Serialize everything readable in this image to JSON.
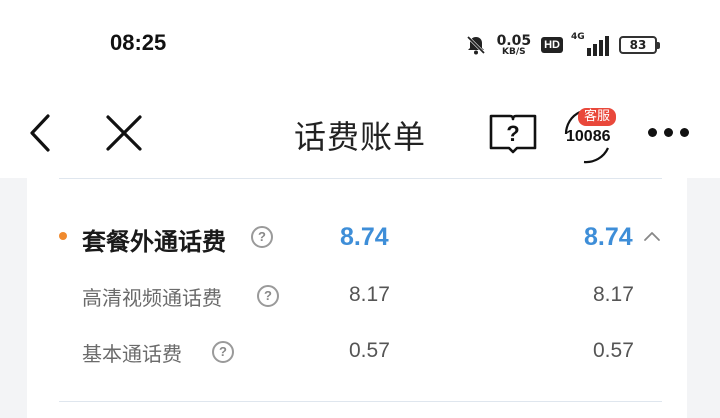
{
  "status_bar": {
    "time": "08:25",
    "net_speed_value": "0.05",
    "net_speed_unit": "KB/S",
    "hd_badge": "HD",
    "network_type": "4G",
    "battery_level": "83",
    "icons": [
      "bell-muted-icon",
      "hd-icon",
      "signal-icon",
      "battery-icon"
    ]
  },
  "nav": {
    "title": "话费账单",
    "help_icon_glyph": "?",
    "cs_badge": "客服",
    "cs_number": "10086",
    "icons": [
      "back-icon",
      "close-icon",
      "help-book-icon",
      "customer-service-icon",
      "more-icon"
    ]
  },
  "bill": {
    "group": {
      "label": "套餐外通话费",
      "amount_1": "8.74",
      "amount_2": "8.74",
      "expanded": true
    },
    "items": [
      {
        "label": "高清视频通话费",
        "amount_1": "8.17",
        "amount_2": "8.17"
      },
      {
        "label": "基本通话费",
        "amount_1": "0.57",
        "amount_2": "0.57"
      }
    ]
  },
  "colors": {
    "accent_blue": "#3e8ed8",
    "bullet_orange": "#f08a2e",
    "badge_red": "#e9483b",
    "page_bg": "#f3f4f6"
  }
}
